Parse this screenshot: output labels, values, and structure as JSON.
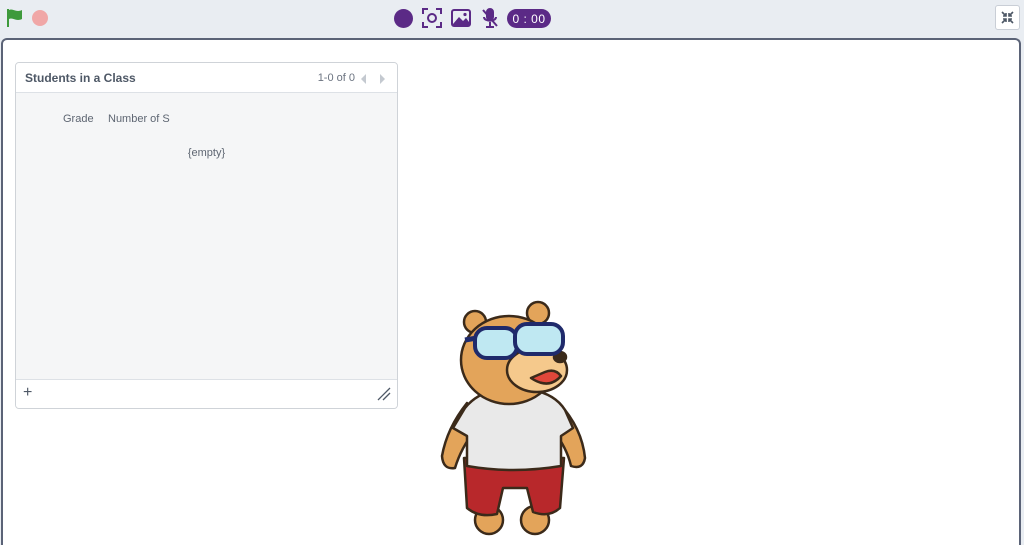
{
  "toolbar": {
    "icons": [
      "green-flag-icon",
      "stop-icon",
      "record-icon",
      "camera-icon",
      "image-icon",
      "microphone-off-icon",
      "shrink-icon"
    ],
    "timer": "0 : 00"
  },
  "list_monitor": {
    "title": "Students in a Class",
    "pager": "1-0 of 0",
    "columns": [
      "Grade",
      "Number of S"
    ],
    "empty_text": "{empty}",
    "add_label": "+"
  },
  "colors": {
    "accent_purple": "#5b2a86",
    "flag_green": "#3e9a3c",
    "stop_red": "#f0a7a7"
  }
}
